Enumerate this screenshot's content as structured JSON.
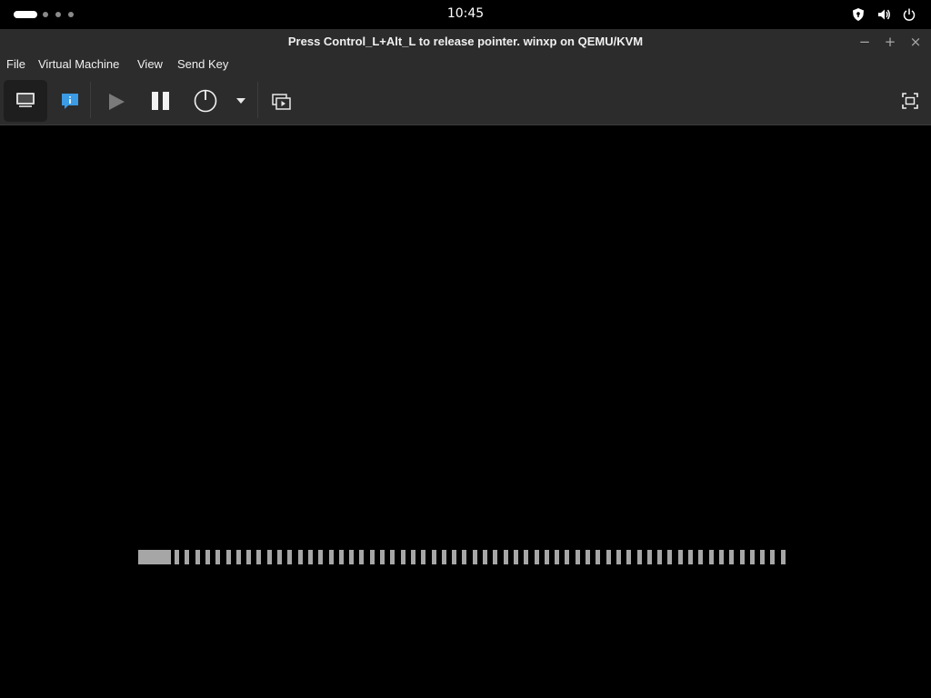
{
  "topbar": {
    "clock": "10:45",
    "tray_icons": [
      "shield-icon",
      "volume-icon",
      "power-icon"
    ]
  },
  "window": {
    "title": "Press Control_L+Alt_L to release pointer. winxp on QEMU/KVM",
    "controls": [
      "minimize-icon",
      "maximize-icon",
      "close-icon"
    ]
  },
  "menu": {
    "items": [
      "File",
      "Virtual Machine",
      "View",
      "Send Key"
    ]
  },
  "toolbar": {
    "buttons": [
      "console-icon",
      "details-icon",
      "run-icon",
      "pause-icon",
      "shutdown-icon",
      "shutdown-menu-icon",
      "snapshots-icon",
      "fullscreen-icon"
    ],
    "active": "console-icon"
  },
  "vm_display": {
    "boot_progress_segments": 60,
    "colors": {
      "background": "#000000",
      "progress": "#a6a6a6"
    }
  }
}
